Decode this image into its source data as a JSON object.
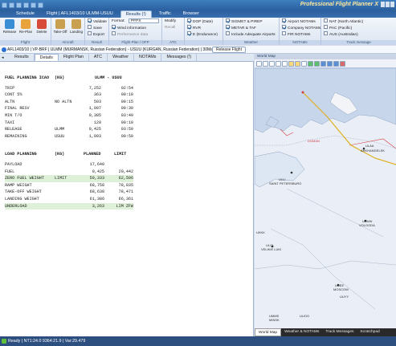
{
  "app_title": "Professional Flight Planner X",
  "window_title": "Flight | AFL1403/10 ULMM-USUU",
  "tabs": [
    "Schedule",
    "Flight | AFL1403/10 ULMM-USUU",
    "Results (!)",
    "Traffic",
    "Browser"
  ],
  "ribbon": {
    "flight_group": {
      "caption": "Flight",
      "buttons": [
        "Release",
        "Re-Plan",
        "Delete"
      ]
    },
    "aircraft_group": {
      "caption": "Aircraft",
      "buttons": [
        "Take-Off",
        "Landing"
      ]
    },
    "result_group": {
      "caption": "Result",
      "items": [
        "Validate",
        "Save",
        "Export"
      ]
    },
    "format_group": {
      "caption": "Flight Plan / OFP",
      "format_label": "Format:",
      "format_value": "PFPX",
      "items": [
        "Wind information",
        "Performance data"
      ]
    },
    "atc_group": {
      "caption": "ATC",
      "items": [
        "Modify",
        "Recall"
      ]
    },
    "enroute_group": {
      "caption": "",
      "items": [
        "DOP (Date)",
        "RVR",
        "E (Endurance)"
      ]
    },
    "weather_group": {
      "caption": "Weather",
      "items": [
        "SIGMET & PIREP",
        "METAR & TAF",
        "Include Adequate Airports"
      ]
    },
    "notam_group": {
      "caption": "NOTAMs",
      "items": [
        "Airport NOTAMs",
        "Company NOTAMs",
        "FIR NOTAMs"
      ]
    },
    "track_group": {
      "caption": "Track message",
      "items": [
        "NAT (North Atlantic)",
        "PAC (Pacific)",
        "AUS (Australian)"
      ]
    }
  },
  "route_line": "AFL1403/10 | VP-BRF | ULMM (MURMANSK, Russian Federation) - USUU (KURGAN, Russian Federation) | 30Mar 02:25UTC",
  "release_flight": "Release Flight",
  "left_tabs": [
    "Results",
    "Details",
    "Flight Plan",
    "ATC",
    "Weather",
    "NOTAMs",
    "Messages (!)"
  ],
  "left_active_tab": "Details",
  "fuel": {
    "header": [
      "FUEL PLANNING ICAO",
      "(KG)",
      "ULMM - USUU"
    ],
    "rows": [
      [
        "TRIP",
        "",
        "7,252",
        "02:54"
      ],
      [
        "CONT 5%",
        "",
        "363",
        "00:10"
      ],
      [
        "ALTN",
        "NO ALTN",
        "503",
        "00:15"
      ],
      [
        "FINAL RESV",
        "",
        "1,097",
        "00:30"
      ],
      [
        "MIN T/O",
        "",
        "9,385",
        "03:49"
      ],
      [
        "TAXI",
        "",
        "120",
        "00:10"
      ],
      [
        "RELEASE",
        "ULMM",
        "9,425",
        "03:59"
      ],
      [
        "REMAINING",
        "USUU",
        "1,993",
        "00:50"
      ]
    ]
  },
  "load": {
    "header": [
      "LOAD PLANNING",
      "(KG)",
      "PLANNED",
      "LIMIT"
    ],
    "rows": [
      [
        "PAYLOAD",
        "",
        "17,640",
        ""
      ],
      [
        "FUEL",
        "",
        "9,425",
        "20,442"
      ],
      [
        "ZERO FUEL WEIGHT",
        "LIMIT",
        "59,333",
        "62,596"
      ],
      [
        "RAMP WEIGHT",
        "",
        "68,758",
        "78,835"
      ],
      [
        "TAKE-OFF WEIGHT",
        "",
        "68,638",
        "78,471"
      ],
      [
        "LANDING WEIGHT",
        "",
        "61,386",
        "66,361"
      ],
      [
        "UNDERLOAD",
        "",
        "3,263",
        "LIM ZFW"
      ]
    ]
  },
  "map": {
    "caption": "World Map",
    "labels": [
      "ULLI",
      "SAINT PETERSBURG",
      "ULWW",
      "VOLOGDA",
      "UUEE",
      "MOSCOW",
      "ULAA",
      "ARKHANGELSK",
      "ULOL",
      "VELIKIE LUKI",
      "UMMS",
      "MINSK",
      "UUOO",
      "UKKK",
      "UUYY",
      "DOMAN"
    ],
    "bottom_tabs": [
      "World Map",
      "Weather & NOTAMs",
      "Track Messages",
      "Scratchpad"
    ]
  },
  "status": "Ready | NT1:24.0 9364:21.9 | Var:29.479",
  "colors": {
    "route": "#e0b020",
    "fir_red": "#d84040",
    "highlight": "#dff0d8",
    "ribbon_blue": "#2b5f9e"
  }
}
